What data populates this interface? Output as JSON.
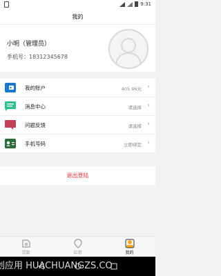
{
  "status_bar": {
    "time": "9:31"
  },
  "header": {
    "title": "我的"
  },
  "profile": {
    "name": "小明（管理员）",
    "phone_label": "手机号：18312345678"
  },
  "menu": [
    {
      "label": "我的账户",
      "value": "405.96元",
      "icon": "wallet-icon",
      "color": "#1a77c9"
    },
    {
      "label": "消息中心",
      "value": "请选择",
      "icon": "message-icon",
      "color": "#2bbf8a"
    },
    {
      "label": "问题反馈",
      "value": "请选择",
      "icon": "feedback-icon",
      "color": "#c0405a"
    },
    {
      "label": "手机号码",
      "value": "立即绑定",
      "icon": "phone-card-icon",
      "color": "#2e6b3a"
    }
  ],
  "logout_label": "退出登陆",
  "tabs": [
    {
      "label": "贷款",
      "icon": "loan-icon",
      "active": false
    },
    {
      "label": "应用",
      "icon": "app-icon",
      "active": false
    },
    {
      "label": "我的",
      "icon": "me-icon",
      "active": true
    }
  ],
  "watermark": "创应用  HUACHUANGZS.CO",
  "colors": {
    "accent_red": "#e8343c",
    "me_tab": "#f5a623"
  }
}
